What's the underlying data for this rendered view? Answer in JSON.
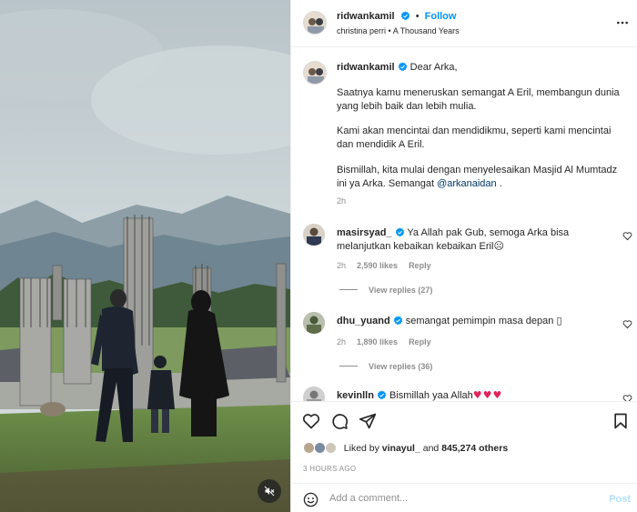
{
  "header": {
    "username": "ridwankamil",
    "separator": "•",
    "follow_label": "Follow",
    "music_artist": "christina perri",
    "music_dot": "•",
    "music_title": "A Thousand Years"
  },
  "caption": {
    "username": "ridwankamil",
    "line1": "Dear Arka,",
    "para1": "Saatnya kamu meneruskan semangat A Eril, membangun dunia yang lebih baik dan lebih mulia.",
    "para2": "Kami akan mencintai dan mendidikmu, seperti kami mencintai dan mendidik A Eril.",
    "para3_before": "Bismillah, kita mulai dengan menyelesaikan Masjid Al Mumtadz ini ya Arka. Semangat ",
    "para3_mention": "@arkanaidan",
    "para3_after": " .",
    "time": "2h"
  },
  "comments": [
    {
      "username": "masirsyad_",
      "text": "Ya Allah pak Gub, semoga Arka bisa melanjutkan kebaikan kebaikan Eril",
      "emoji": "☹",
      "time": "2h",
      "likes": "2,590 likes",
      "reply_label": "Reply",
      "view_replies": "View replies (27)"
    },
    {
      "username": "dhu_yuand",
      "text": "semangat pemimpin masa depan",
      "emoji": "▯",
      "time": "2h",
      "likes": "1,890 likes",
      "reply_label": "Reply",
      "view_replies": "View replies (36)"
    },
    {
      "username": "kevinlln",
      "text": "Bismillah yaa Allah",
      "emoji": "♥♥♥"
    }
  ],
  "likes": {
    "prefix": "Liked by",
    "user": "vinayul_",
    "middle": "and",
    "count": "845,274 others"
  },
  "time_ago": "3 HOURS AGO",
  "add_comment": {
    "placeholder": "Add a comment...",
    "post_label": "Post"
  },
  "icons": {
    "verified": "verified-badge-icon",
    "more": "more-options-icon",
    "like": "heart-icon",
    "comment": "comment-bubble-icon",
    "share": "paper-plane-icon",
    "save": "bookmark-icon",
    "emoji": "smiley-icon",
    "mute": "speaker-muted-icon"
  },
  "colors": {
    "accent": "#0095f6",
    "verified": "#0095f6",
    "muted_text": "#8e8e8e",
    "heart_red": "#e0245e"
  }
}
